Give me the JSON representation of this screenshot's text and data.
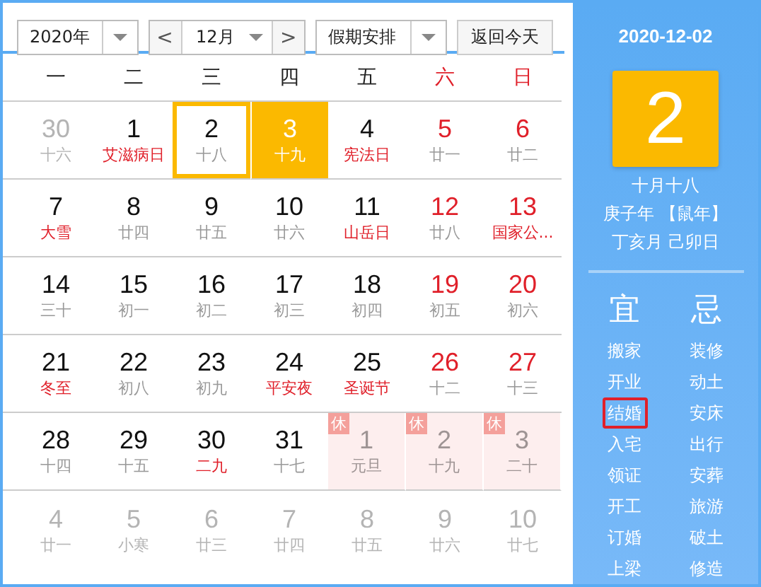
{
  "toolbar": {
    "year": "2020年",
    "prev": "<",
    "month": "12月",
    "next": ">",
    "holiday": "假期安排",
    "today_button": "返回今天"
  },
  "weekdays": [
    {
      "label": "一",
      "weekend": false
    },
    {
      "label": "二",
      "weekend": false
    },
    {
      "label": "三",
      "weekend": false
    },
    {
      "label": "四",
      "weekend": false
    },
    {
      "label": "五",
      "weekend": false
    },
    {
      "label": "六",
      "weekend": true
    },
    {
      "label": "日",
      "weekend": true
    }
  ],
  "days": [
    {
      "day": "30",
      "lunar": "十六",
      "other_month": true,
      "selected": false,
      "today": false
    },
    {
      "day": "1",
      "lunar": "艾滋病日",
      "other_month": false,
      "weekend": false,
      "festival": true,
      "selected": false,
      "today": false
    },
    {
      "day": "2",
      "lunar": "十八",
      "other_month": false,
      "weekend": false,
      "festival": false,
      "selected": true,
      "today": false
    },
    {
      "day": "3",
      "lunar": "十九",
      "other_month": false,
      "weekend": false,
      "festival": false,
      "selected": false,
      "today": true
    },
    {
      "day": "4",
      "lunar": "宪法日",
      "other_month": false,
      "weekend": false,
      "festival": true,
      "selected": false,
      "today": false
    },
    {
      "day": "5",
      "lunar": "廿一",
      "other_month": false,
      "weekend": true,
      "festival": false,
      "selected": false,
      "today": false
    },
    {
      "day": "6",
      "lunar": "廿二",
      "other_month": false,
      "weekend": true,
      "festival": false,
      "selected": false,
      "today": false
    },
    {
      "day": "7",
      "lunar": "大雪",
      "other_month": false,
      "weekend": false,
      "festival": true,
      "selected": false,
      "today": false
    },
    {
      "day": "8",
      "lunar": "廿四",
      "other_month": false,
      "weekend": false,
      "festival": false,
      "selected": false,
      "today": false
    },
    {
      "day": "9",
      "lunar": "廿五",
      "other_month": false,
      "weekend": false,
      "festival": false,
      "selected": false,
      "today": false
    },
    {
      "day": "10",
      "lunar": "廿六",
      "other_month": false,
      "weekend": false,
      "festival": false,
      "selected": false,
      "today": false
    },
    {
      "day": "11",
      "lunar": "山岳日",
      "other_month": false,
      "weekend": false,
      "festival": true,
      "selected": false,
      "today": false
    },
    {
      "day": "12",
      "lunar": "廿八",
      "other_month": false,
      "weekend": true,
      "festival": false,
      "selected": false,
      "today": false
    },
    {
      "day": "13",
      "lunar": "国家公...",
      "other_month": false,
      "weekend": true,
      "festival": true,
      "selected": false,
      "today": false
    },
    {
      "day": "14",
      "lunar": "三十",
      "other_month": false,
      "weekend": false,
      "festival": false,
      "selected": false,
      "today": false
    },
    {
      "day": "15",
      "lunar": "初一",
      "other_month": false,
      "weekend": false,
      "festival": false,
      "selected": false,
      "today": false
    },
    {
      "day": "16",
      "lunar": "初二",
      "other_month": false,
      "weekend": false,
      "festival": false,
      "selected": false,
      "today": false
    },
    {
      "day": "17",
      "lunar": "初三",
      "other_month": false,
      "weekend": false,
      "festival": false,
      "selected": false,
      "today": false
    },
    {
      "day": "18",
      "lunar": "初四",
      "other_month": false,
      "weekend": false,
      "festival": false,
      "selected": false,
      "today": false
    },
    {
      "day": "19",
      "lunar": "初五",
      "other_month": false,
      "weekend": true,
      "festival": false,
      "selected": false,
      "today": false
    },
    {
      "day": "20",
      "lunar": "初六",
      "other_month": false,
      "weekend": true,
      "festival": false,
      "selected": false,
      "today": false
    },
    {
      "day": "21",
      "lunar": "冬至",
      "other_month": false,
      "weekend": false,
      "festival": true,
      "selected": false,
      "today": false
    },
    {
      "day": "22",
      "lunar": "初八",
      "other_month": false,
      "weekend": false,
      "festival": false,
      "selected": false,
      "today": false
    },
    {
      "day": "23",
      "lunar": "初九",
      "other_month": false,
      "weekend": false,
      "festival": false,
      "selected": false,
      "today": false
    },
    {
      "day": "24",
      "lunar": "平安夜",
      "other_month": false,
      "weekend": false,
      "festival": true,
      "selected": false,
      "today": false
    },
    {
      "day": "25",
      "lunar": "圣诞节",
      "other_month": false,
      "weekend": false,
      "festival": true,
      "selected": false,
      "today": false
    },
    {
      "day": "26",
      "lunar": "十二",
      "other_month": false,
      "weekend": true,
      "festival": false,
      "selected": false,
      "today": false
    },
    {
      "day": "27",
      "lunar": "十三",
      "other_month": false,
      "weekend": true,
      "festival": false,
      "selected": false,
      "today": false
    },
    {
      "day": "28",
      "lunar": "十四",
      "other_month": false,
      "weekend": false,
      "festival": false,
      "selected": false,
      "today": false
    },
    {
      "day": "29",
      "lunar": "十五",
      "other_month": false,
      "weekend": false,
      "festival": false,
      "selected": false,
      "today": false
    },
    {
      "day": "30",
      "lunar": "二九",
      "other_month": false,
      "weekend": false,
      "festival": true,
      "selected": false,
      "today": false
    },
    {
      "day": "31",
      "lunar": "十七",
      "other_month": false,
      "weekend": false,
      "festival": false,
      "selected": false,
      "today": false
    },
    {
      "day": "1",
      "lunar": "元旦",
      "other_month": true,
      "selected": false,
      "today": false,
      "badge": "休"
    },
    {
      "day": "2",
      "lunar": "十九",
      "other_month": true,
      "selected": false,
      "today": false,
      "badge": "休"
    },
    {
      "day": "3",
      "lunar": "二十",
      "other_month": true,
      "selected": false,
      "today": false,
      "badge": "休"
    },
    {
      "day": "4",
      "lunar": "廿一",
      "other_month": true,
      "selected": false,
      "today": false
    },
    {
      "day": "5",
      "lunar": "小寒",
      "other_month": true,
      "selected": false,
      "today": false
    },
    {
      "day": "6",
      "lunar": "廿三",
      "other_month": true,
      "selected": false,
      "today": false
    },
    {
      "day": "7",
      "lunar": "廿四",
      "other_month": true,
      "selected": false,
      "today": false
    },
    {
      "day": "8",
      "lunar": "廿五",
      "other_month": true,
      "selected": false,
      "today": false
    },
    {
      "day": "9",
      "lunar": "廿六",
      "other_month": true,
      "selected": false,
      "today": false
    },
    {
      "day": "10",
      "lunar": "廿七",
      "other_month": true,
      "selected": false,
      "today": false
    }
  ],
  "side": {
    "date": "2020-12-02",
    "big_day": "2",
    "lunar_lines": [
      "十月十八",
      "庚子年 【鼠年】",
      "丁亥月 己卯日"
    ],
    "yi_title": "宜",
    "ji_title": "忌",
    "yi": [
      {
        "label": "搬家",
        "selected": false
      },
      {
        "label": "开业",
        "selected": false
      },
      {
        "label": "结婚",
        "selected": true
      },
      {
        "label": "入宅",
        "selected": false
      },
      {
        "label": "领证",
        "selected": false
      },
      {
        "label": "开工",
        "selected": false
      },
      {
        "label": "订婚",
        "selected": false
      },
      {
        "label": "上梁",
        "selected": false
      }
    ],
    "ji": [
      {
        "label": "装修",
        "selected": false
      },
      {
        "label": "动土",
        "selected": false
      },
      {
        "label": "安床",
        "selected": false
      },
      {
        "label": "出行",
        "selected": false
      },
      {
        "label": "安葬",
        "selected": false
      },
      {
        "label": "旅游",
        "selected": false
      },
      {
        "label": "破土",
        "selected": false
      },
      {
        "label": "修造",
        "selected": false
      }
    ]
  }
}
